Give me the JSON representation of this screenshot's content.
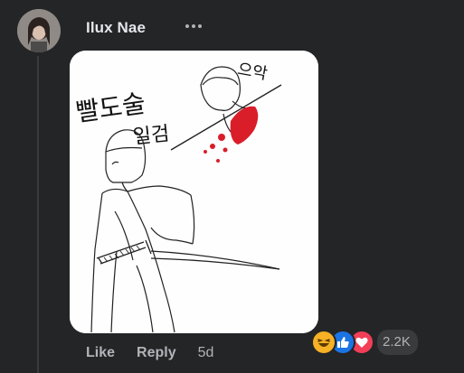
{
  "comment": {
    "author": "Ilux Nae",
    "timestamp": "5d",
    "avatar_icon": "user-avatar"
  },
  "actions": {
    "like_label": "Like",
    "reply_label": "Reply"
  },
  "reactions": {
    "count": "2.2K",
    "types": [
      "haha",
      "like",
      "love"
    ]
  },
  "drawing": {
    "text_left": "빨도술 일검",
    "text_top_right": "으악"
  },
  "colors": {
    "background": "#242526",
    "text_primary": "#e4e6eb",
    "text_secondary": "#b0b3b8",
    "like_blue": "#1b74e4",
    "love_red": "#f33e58",
    "haha_yellow": "#f7b125",
    "blood_red": "#d91e2a"
  }
}
